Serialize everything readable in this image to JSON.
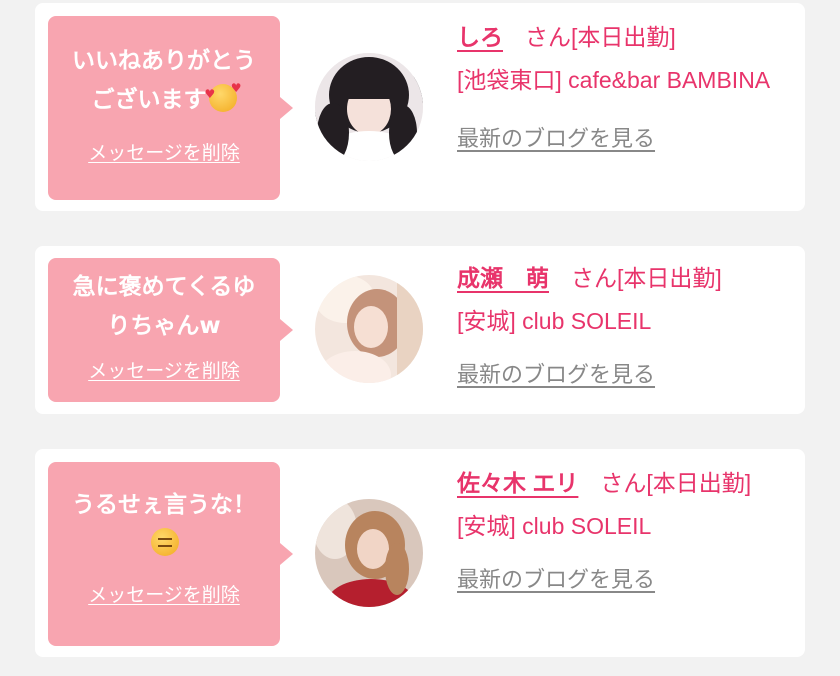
{
  "colors": {
    "background": "#f2f2f2",
    "card": "#ffffff",
    "bubble": "#f8a5b0",
    "accent": "#e8346b",
    "link_gray": "#888888"
  },
  "messages": [
    {
      "text": "いいねありがとう\nございます",
      "emoji": "smiling-face-with-hearts-emoji",
      "delete_label": "メッセージを削除",
      "avatar": "girl-portrait-photo-1",
      "name": "しろ",
      "suffix": "さん[本日出勤]",
      "shop": "[池袋東口] cafe&bar BAMBINA",
      "blog_label": "最新のブログを見る"
    },
    {
      "text": "急に褒めてくるゆ\nりちゃんw",
      "emoji": "",
      "delete_label": "メッセージを削除",
      "avatar": "girl-portrait-photo-2",
      "name": "成瀬　萌",
      "suffix": "さん[本日出勤]",
      "shop": "[安城] club SOLEIL",
      "blog_label": "最新のブログを見る"
    },
    {
      "text": "うるせぇ言うな！",
      "emoji": "expressionless-face-emoji",
      "delete_label": "メッセージを削除",
      "avatar": "girl-portrait-photo-3",
      "name": "佐々木 エリ",
      "suffix": "さん[本日出勤]",
      "shop": "[安城] club SOLEIL",
      "blog_label": "最新のブログを見る"
    }
  ]
}
